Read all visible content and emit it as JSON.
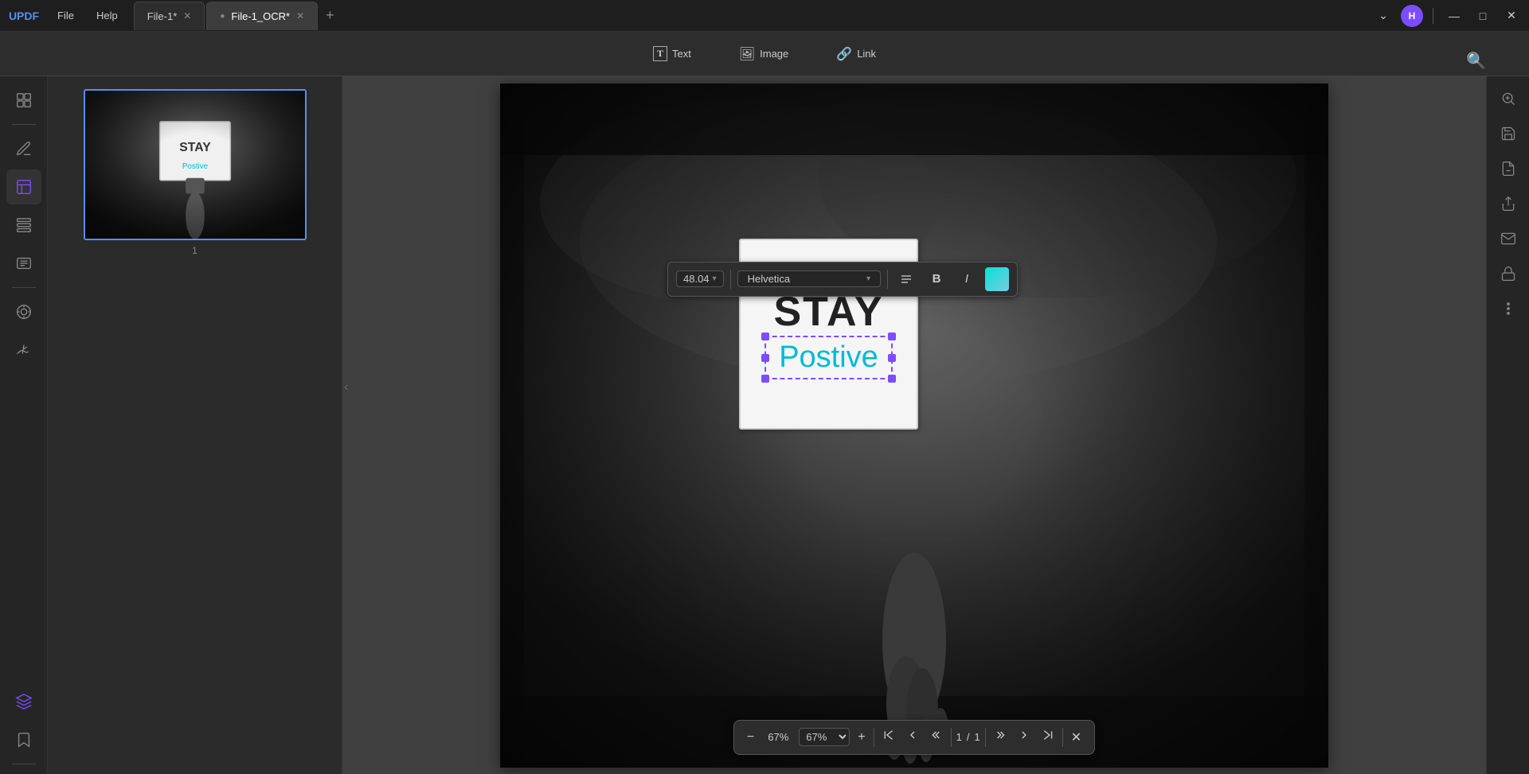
{
  "app": {
    "name": "UPDF",
    "logo": "UPDF"
  },
  "titlebar": {
    "menu": [
      "File",
      "Help"
    ],
    "tabs": [
      {
        "id": "tab1",
        "label": "File-1*",
        "active": false,
        "closable": true
      },
      {
        "id": "tab2",
        "label": "File-1_OCR*",
        "active": true,
        "closable": true
      }
    ],
    "add_tab_label": "+",
    "user_initial": "H",
    "window_controls": [
      "—",
      "□",
      "✕"
    ]
  },
  "toolbar": {
    "items": [
      {
        "id": "text",
        "label": "Text",
        "icon": "T"
      },
      {
        "id": "image",
        "label": "Image",
        "icon": "🖼"
      },
      {
        "id": "link",
        "label": "Link",
        "icon": "🔗"
      }
    ]
  },
  "left_sidebar": {
    "icons": [
      {
        "id": "pages",
        "symbol": "⊞",
        "active": false
      },
      {
        "id": "edit",
        "symbol": "✏",
        "active": false
      },
      {
        "id": "annotate",
        "symbol": "📝",
        "active": true
      },
      {
        "id": "organize",
        "symbol": "▤",
        "active": false
      },
      {
        "id": "forms",
        "symbol": "≡",
        "active": false
      },
      {
        "id": "ocr",
        "symbol": "⊙",
        "active": false
      },
      {
        "id": "signature",
        "symbol": "✒",
        "active": false
      }
    ],
    "bottom_icons": [
      {
        "id": "layers",
        "symbol": "◧"
      },
      {
        "id": "bookmark",
        "symbol": "🔖"
      }
    ]
  },
  "thumbnail": {
    "page_number": "1",
    "sign_text": "STAY",
    "sign_sub": "Postive"
  },
  "text_toolbar": {
    "font_size": "48.04",
    "font_name": "Helvetica",
    "align_icon": "≡",
    "bold_label": "B",
    "italic_label": "I",
    "color_label": "color"
  },
  "sign_card": {
    "main_text": "STAY",
    "sub_text": "Postive"
  },
  "bottom_bar": {
    "zoom_out": "−",
    "zoom_percent": "67%",
    "zoom_in": "+",
    "first_page": "⏮",
    "prev_page": "▲",
    "page_current": "1",
    "page_separator": "/",
    "page_total": "1",
    "next_page": "▼",
    "last_page": "⏭",
    "close": "✕"
  },
  "right_sidebar": {
    "icons": [
      {
        "id": "save-to-pdf",
        "symbol": "💾"
      },
      {
        "id": "save-to-other",
        "symbol": "📄"
      },
      {
        "id": "share",
        "symbol": "↑"
      },
      {
        "id": "email",
        "symbol": "✉"
      },
      {
        "id": "protect",
        "symbol": "🔒"
      },
      {
        "id": "more",
        "symbol": "⋯"
      }
    ]
  }
}
